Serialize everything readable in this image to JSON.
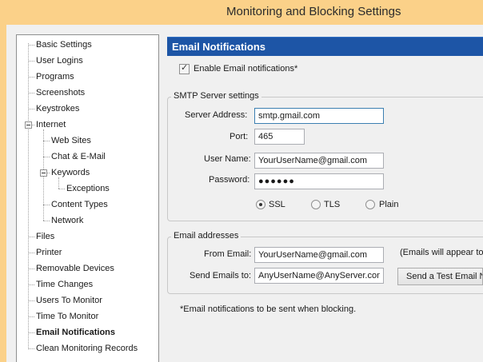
{
  "window": {
    "title": "Monitoring and Blocking Settings"
  },
  "tree": {
    "items": [
      "Basic Settings",
      "User Logins",
      "Programs",
      "Screenshots",
      "Keystrokes",
      "Internet",
      "Web Sites",
      "Chat & E-Mail",
      "Keywords",
      "Exceptions",
      "Content Types",
      "Network",
      "Files",
      "Printer",
      "Removable Devices",
      "Time Changes",
      "Users To Monitor",
      "Time To Monitor",
      "Email Notifications",
      "Clean Monitoring Records"
    ],
    "selected": "Email Notifications"
  },
  "panel": {
    "header": "Email Notifications",
    "enable_label": "Enable Email notifications*",
    "enable_checked": true,
    "smtp": {
      "legend": "SMTP Server settings",
      "server_label": "Server Address:",
      "server_value": "smtp.gmail.com",
      "port_label": "Port:",
      "port_value": "465",
      "username_label": "User Name:",
      "username_value": "YourUserName@gmail.com",
      "password_label": "Password:",
      "password_value": "●●●●●●",
      "security_options": [
        "SSL",
        "TLS",
        "Plain"
      ],
      "security_selected": "SSL"
    },
    "addresses": {
      "legend": "Email addresses",
      "from_label": "From Email:",
      "from_value": "YourUserName@gmail.com",
      "send_label": "Send Emails to:",
      "send_value": "AnyUserName@AnyServer.com",
      "note": "(Emails will appear to b",
      "test_button": "Send a Test Email No"
    },
    "footnote": "*Email notifications to be sent when blocking."
  }
}
